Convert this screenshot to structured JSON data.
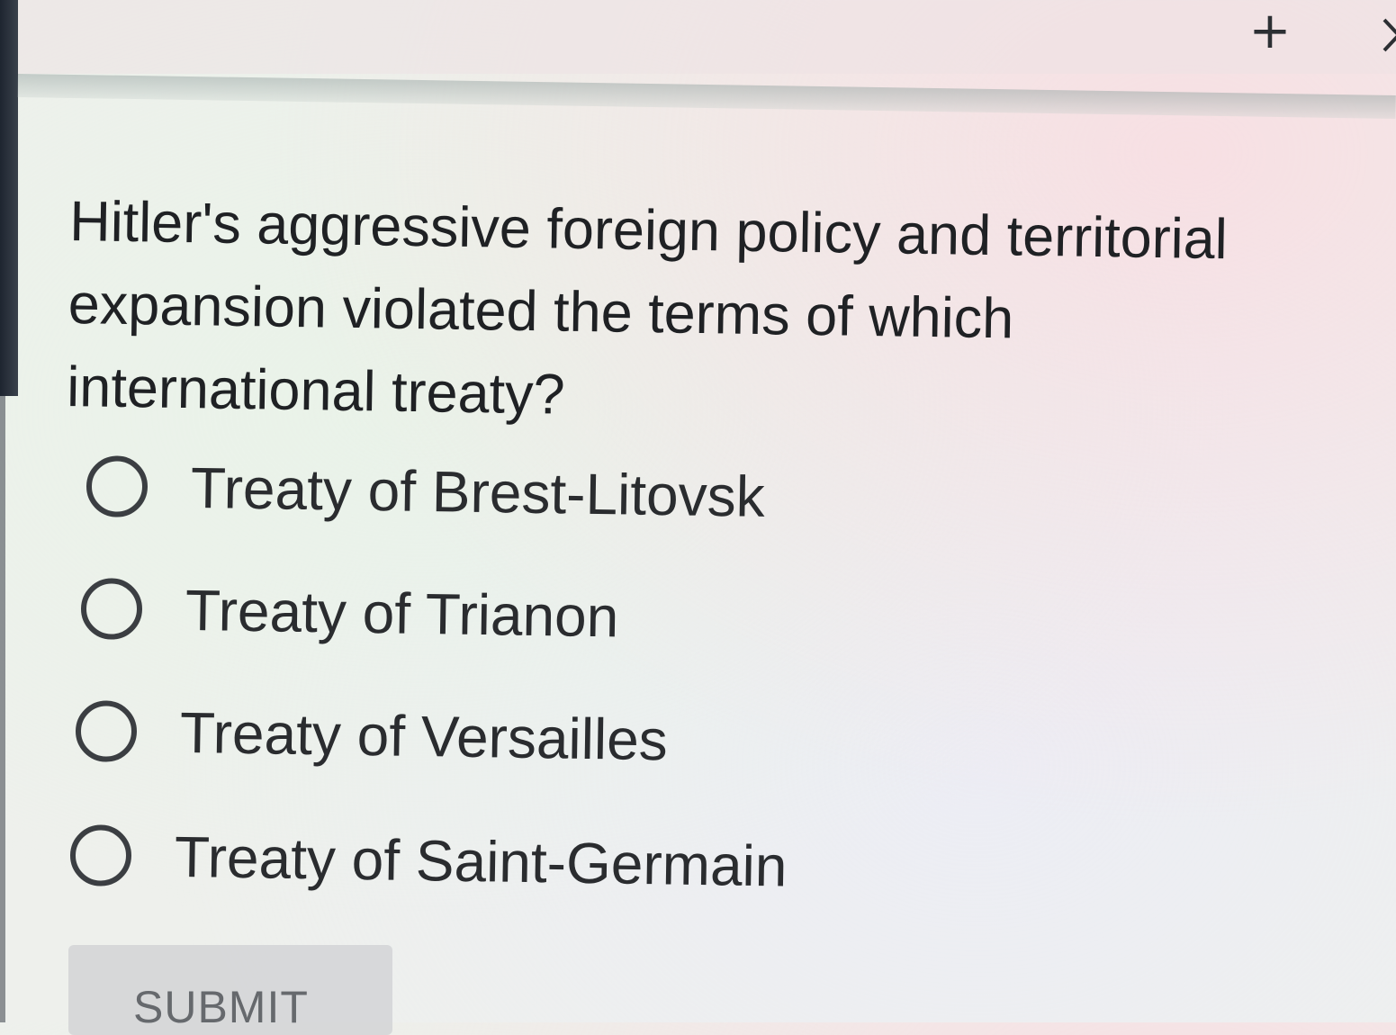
{
  "header": {
    "add_icon": "plus-icon",
    "next_icon": "chevron-right-icon"
  },
  "question": {
    "text": "Hitler's aggressive foreign policy and territorial expansion violated the terms of which international treaty?"
  },
  "options": [
    {
      "label": "Treaty of Brest-Litovsk",
      "selected": false
    },
    {
      "label": "Treaty of Trianon",
      "selected": false
    },
    {
      "label": "Treaty of Versailles",
      "selected": false
    },
    {
      "label": "Treaty of Saint-Germain",
      "selected": false
    }
  ],
  "submit": {
    "label": "SUBMIT"
  }
}
